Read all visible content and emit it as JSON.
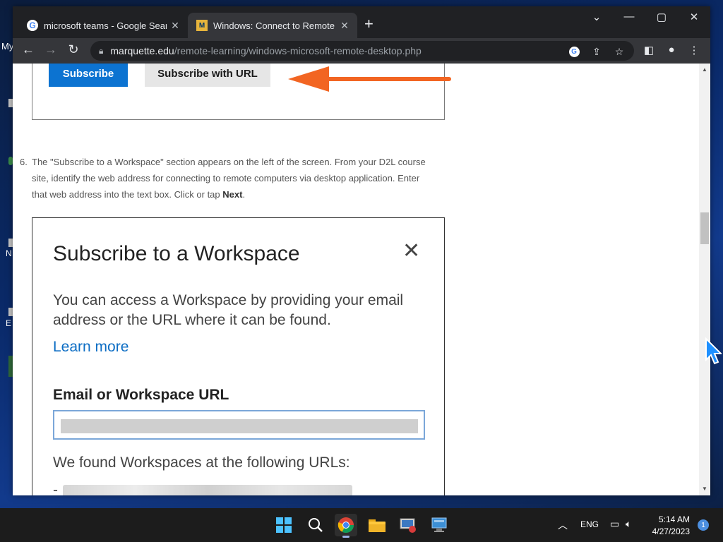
{
  "desktop": {
    "label_my": "My",
    "letters": [
      "N",
      "E"
    ]
  },
  "browser": {
    "tabs": [
      {
        "title": "microsoft teams - Google Search",
        "favicon": "google-icon",
        "active": false
      },
      {
        "title": "Windows: Connect to Remote Co",
        "favicon": "marquette-icon",
        "active": true
      }
    ],
    "url_host": "marquette.edu",
    "url_path": "/remote-learning/windows-microsoft-remote-desktop.php"
  },
  "page": {
    "subscribe_label": "Subscribe",
    "subscribe_url_label": "Subscribe with URL",
    "step_number": "6.",
    "step_text": "The \"Subscribe to a Workspace\" section appears on the left of the screen. From your D2L course site, identify the web address for connecting to remote computers via desktop application. Enter that web address into the text box. Click or tap ",
    "step_strong": "Next",
    "step_end": ".",
    "dialog": {
      "title": "Subscribe to a Workspace",
      "description": "You can access a Workspace by providing your email address or the URL where it can be found.",
      "learn_more": "Learn more",
      "field_label": "Email or Workspace URL",
      "found_text": "We found Workspaces at the following URLs:",
      "dash": "-"
    }
  },
  "taskbar": {
    "language": "ENG",
    "time": "5:14 AM",
    "date": "4/27/2023",
    "notification_count": "1"
  },
  "colors": {
    "subscribe_blue": "#0c73d1",
    "arrow_orange": "#f26522",
    "link_blue": "#0c6dc4"
  }
}
